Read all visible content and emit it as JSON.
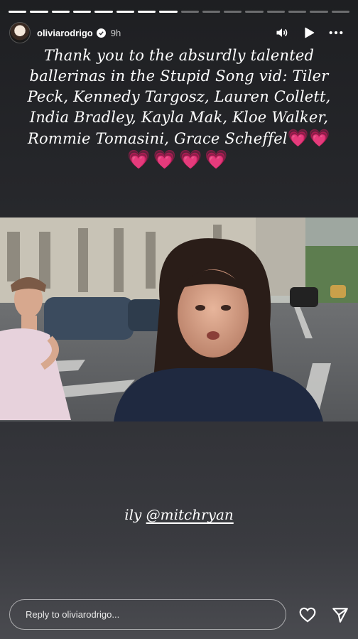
{
  "story": {
    "progress_total": 16,
    "progress_done": 8,
    "username": "oliviarodrigo",
    "time_ago": "9h",
    "verified": true
  },
  "caption": {
    "text": "Thank you to the absurdly talented ballerinas in the Stupid Song vid: Tiler Peck, Kennedy Targosz, Lauren Collett, India Bradley, Kayla Mak, Kloe Walker, Rommie Tomasini, Grace Scheffel",
    "hearts_inline": "💗💗",
    "hearts_line": "💗💗💗💗"
  },
  "mention": {
    "prefix": "ily",
    "handle": "@mitchryan"
  },
  "reply": {
    "placeholder": "Reply to oliviarodrigo..."
  },
  "icons": {
    "mute": "speaker-icon",
    "play": "play-icon",
    "more": "more-icon",
    "like": "heart-icon",
    "share": "send-icon"
  },
  "colors": {
    "heart_pink": "#ff2fa7",
    "background": "#2b2c30"
  }
}
